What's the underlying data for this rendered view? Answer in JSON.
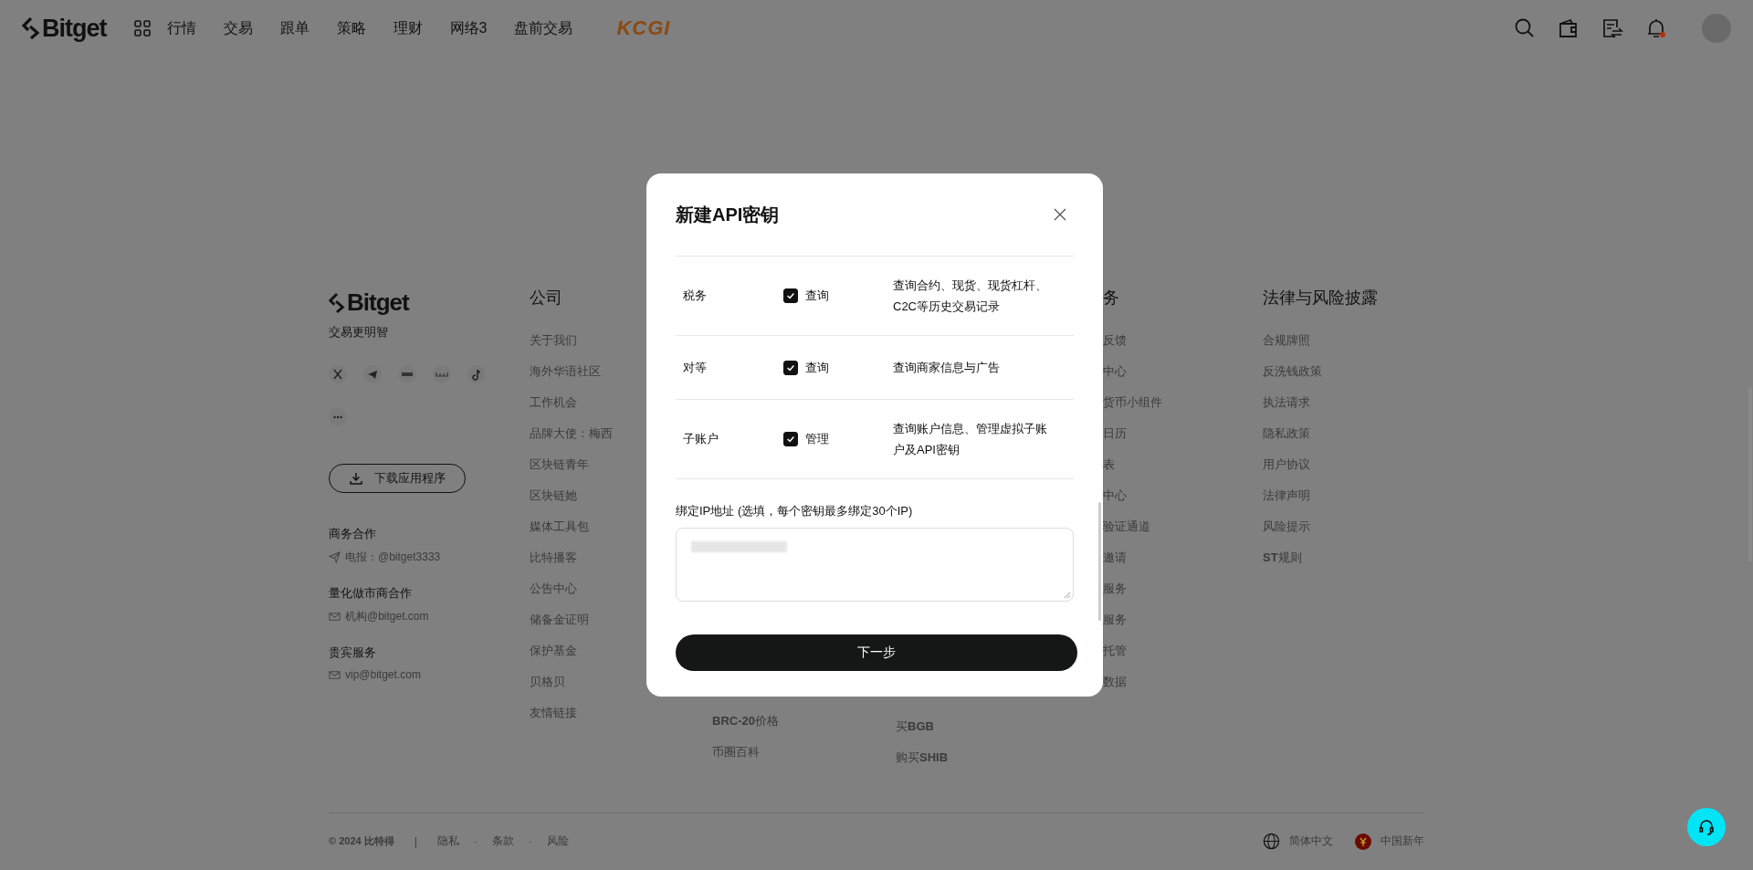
{
  "header": {
    "logo": "Bitget",
    "nav": [
      "行情",
      "交易",
      "跟单",
      "策略",
      "理财",
      "网络3",
      "盘前交易"
    ],
    "promo": "KCGI"
  },
  "footer": {
    "brand": {
      "logo": "Bitget",
      "slogan": "交易更明智"
    },
    "download_button": "下载应用程序",
    "contacts": [
      {
        "title": "商务合作",
        "detail": "电报：@bitget3333",
        "kind": "telegram"
      },
      {
        "title": "量化做市商合作",
        "detail": "机构@bitget.com",
        "kind": "mail"
      },
      {
        "title": "贵宾服务",
        "detail": "vip@bitget.com",
        "kind": "mail"
      }
    ],
    "columns": [
      {
        "heading": "公司",
        "items": [
          "关于我们",
          "海外华语社区",
          "工作机会",
          "品牌大使：梅西",
          "区块链青年",
          "区块链她",
          "媒体工具包",
          "比特播客",
          "公告中心",
          "储备金证明",
          "保护基金",
          "贝格贝",
          "友情链接"
        ]
      },
      {
        "items": [
          "**BRC-20**价格",
          "币圈百科"
        ]
      },
      {
        "items": [
          "买**BGB**",
          "购买**SHIB**"
        ]
      },
      {
        "heading": "务",
        "items": [
          "反馈",
          "中心",
          "货币小组件",
          "日历",
          "表",
          "中心",
          "验证通道",
          "邀请",
          "服务",
          "服务",
          "托管",
          "数据"
        ]
      },
      {
        "heading": "法律与风险披露",
        "items": [
          "合规牌照",
          "反洗钱政策",
          "执法请求",
          "隐私政策",
          "用户协议",
          "法律声明",
          "风险提示",
          "**ST**规则"
        ]
      }
    ],
    "bottom": {
      "copyright": "© 2024 比特得",
      "separator": "|",
      "links": [
        "隐私",
        "条款",
        "风险"
      ],
      "link_separator": "·",
      "language": "简体中文",
      "region": "中国新年"
    }
  },
  "modal": {
    "title": "新建API密钥",
    "permissions": [
      {
        "name": "税务",
        "option": "查询",
        "checked": true,
        "description": "查询合约、现货、现货杠杆、C2C等历史交易记录"
      },
      {
        "name": "对等",
        "option": "查询",
        "checked": true,
        "description": "查询商家信息与广告"
      },
      {
        "name": "子账户",
        "option": "管理",
        "checked": true,
        "description": "查询账户信息、管理虚拟子账户及API密钥"
      }
    ],
    "ip_label": "绑定IP地址 (选填，每个密钥最多绑定30个IP)",
    "next_button": "下一步"
  }
}
